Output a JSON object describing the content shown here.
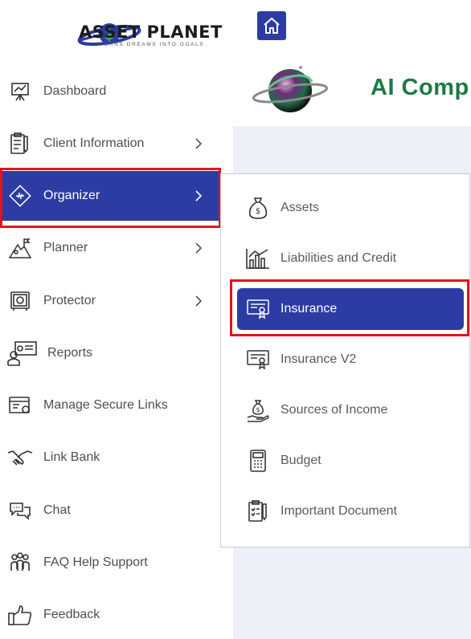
{
  "brand": {
    "name": "ASSET PLANET",
    "tagline": "TURNS DREAMS INTO GOALS"
  },
  "header": {
    "title": "AI Comp"
  },
  "sidebar": {
    "items": [
      {
        "label": "Dashboard",
        "icon": "dashboard-easel-icon"
      },
      {
        "label": "Client Information",
        "icon": "clipboard-pen-icon"
      },
      {
        "label": "Organizer",
        "icon": "organizer-diamond-icon",
        "active": true
      },
      {
        "label": "Planner",
        "icon": "mountain-flag-icon"
      },
      {
        "label": "Protector",
        "icon": "safe-icon"
      },
      {
        "label": "Reports",
        "icon": "presentation-person-icon"
      },
      {
        "label": "Manage Secure Links",
        "icon": "browser-link-icon"
      },
      {
        "label": "Link Bank",
        "icon": "handshake-icon"
      },
      {
        "label": "Chat",
        "icon": "chat-bubbles-icon"
      },
      {
        "label": "FAQ Help Support",
        "icon": "group-people-icon"
      },
      {
        "label": "Feedback",
        "icon": "thumbs-up-icon"
      }
    ]
  },
  "submenu": {
    "items": [
      {
        "label": "Assets",
        "icon": "money-bag-icon"
      },
      {
        "label": "Liabilities and Credit",
        "icon": "bar-chart-icon"
      },
      {
        "label": "Insurance",
        "icon": "certificate-icon",
        "active": true
      },
      {
        "label": "Insurance V2",
        "icon": "certificate-icon"
      },
      {
        "label": "Sources of Income",
        "icon": "hand-money-icon"
      },
      {
        "label": "Budget",
        "icon": "calculator-icon"
      },
      {
        "label": "Important Document",
        "icon": "checklist-pen-icon"
      }
    ]
  },
  "colors": {
    "accent": "#2d3ca4",
    "highlight_border": "#e1141a",
    "title_green": "#1f7a45",
    "content_bg": "#edf0f9"
  }
}
